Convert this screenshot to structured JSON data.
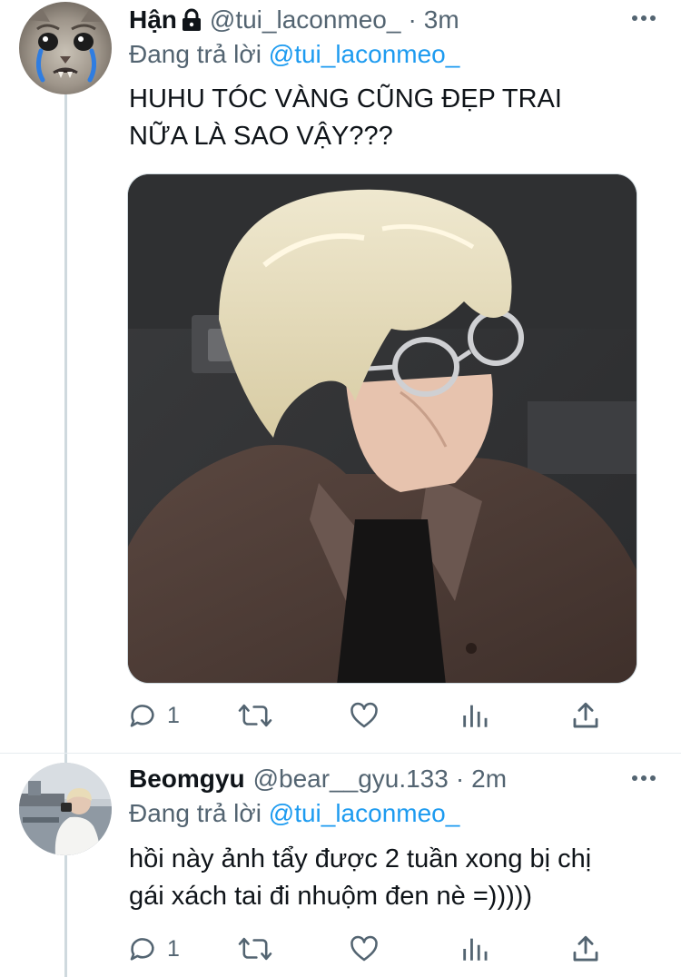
{
  "tweets": [
    {
      "author": "Hận",
      "handle": "@tui_laconmeo_",
      "separator": "·",
      "time": "3m",
      "reply_prefix": "Đang trả lời",
      "reply_to": "@tui_laconmeo_",
      "text_line1": "HUHU TÓC VÀNG CŨNG ĐẸP TRAI",
      "text_line2": "NỮA LÀ SAO VẬY???",
      "reply_count": "1"
    },
    {
      "author": "Beomgyu",
      "handle": "@bear__gyu.133",
      "separator": "·",
      "time": "2m",
      "reply_prefix": "Đang trả lời",
      "reply_to": "@tui_laconmeo_",
      "text_line1": "hồi này ảnh tẩy được 2 tuần xong bị chị",
      "text_line2": "gái xách tai đi nhuộm đen nè =)))))",
      "reply_count": "1"
    }
  ],
  "icons": [
    "lock-icon",
    "more-icon",
    "reply-icon",
    "retweet-icon",
    "like-icon",
    "analytics-icon",
    "share-icon"
  ],
  "colors": {
    "text": "#0f1419",
    "secondary": "#536471",
    "mention": "#1d9bf0",
    "thread_line": "#cfd9de"
  }
}
